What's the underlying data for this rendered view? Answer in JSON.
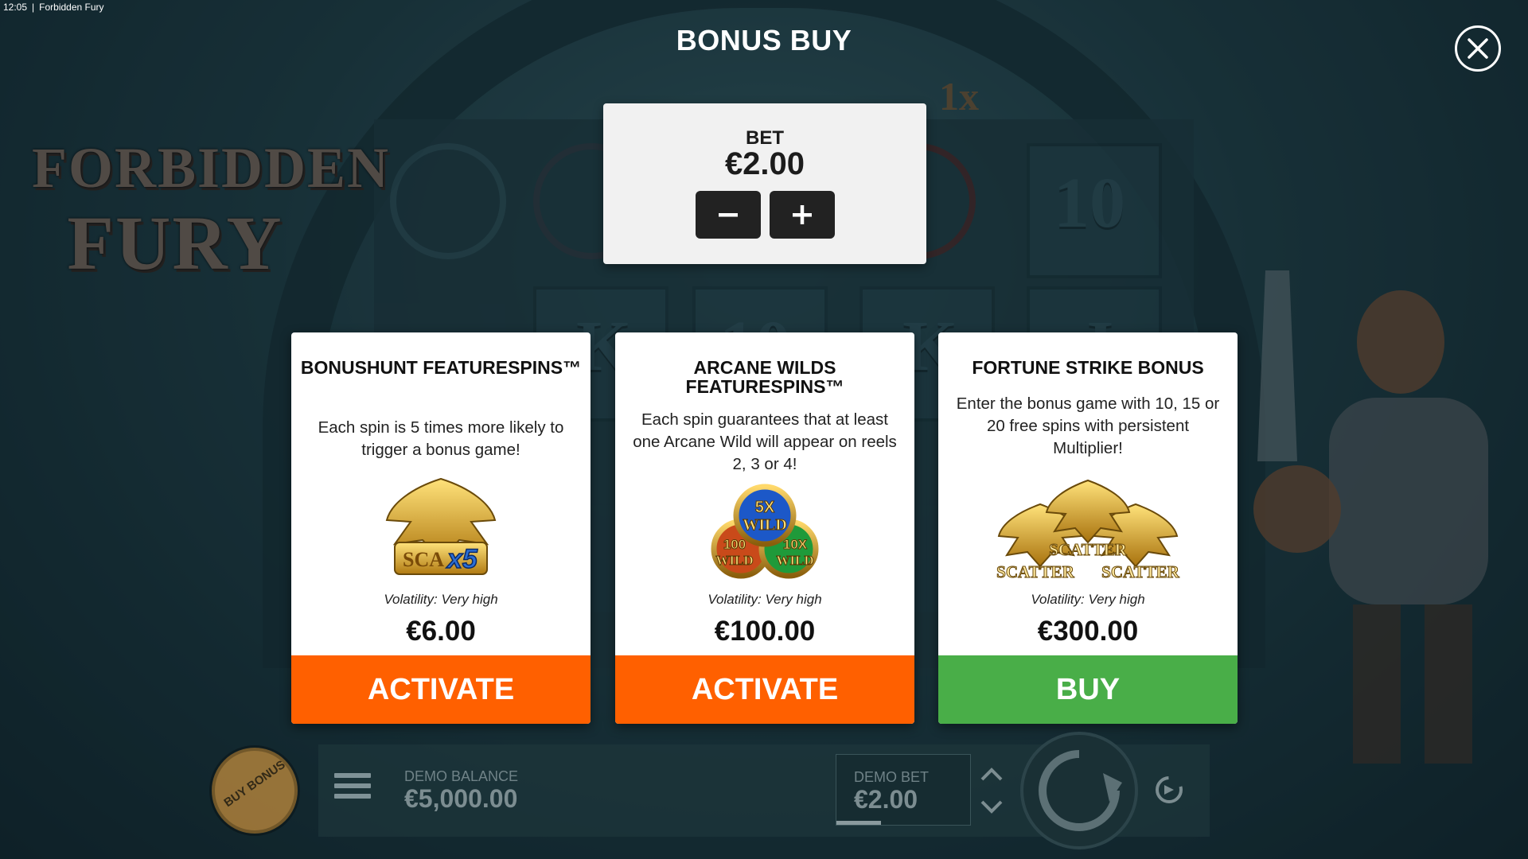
{
  "status_bar": {
    "time": "12:05",
    "app_title": "Forbidden Fury"
  },
  "game": {
    "logo_line1": "FORBIDDEN",
    "logo_line2": "FURY",
    "multiplier": "1x",
    "reel_symbols": [
      "10",
      "K",
      "10",
      "K",
      "J"
    ]
  },
  "dialog": {
    "title": "BONUS BUY"
  },
  "bet_panel": {
    "label": "BET",
    "value": "€2.00"
  },
  "cards": [
    {
      "title": "BONUSHUNT FEATURESPINS™",
      "description": "Each spin is 5 times more likely to trigger a bonus game!",
      "art_text": [
        "SCA",
        "x5"
      ],
      "volatility": "Volatility: Very high",
      "price": "€6.00",
      "action": "ACTIVATE",
      "action_color": "#ff6000"
    },
    {
      "title": "ARCANE WILDS FEATURESPINS™",
      "description": "Each spin guarantees that at least one Arcane Wild will appear on reels 2, 3 or 4!",
      "art_text": [
        "5X",
        "WILD",
        "100",
        "WILD",
        "10X",
        "WILD"
      ],
      "volatility": "Volatility: Very high",
      "price": "€100.00",
      "action": "ACTIVATE",
      "action_color": "#ff6000"
    },
    {
      "title": "FORTUNE STRIKE BONUS",
      "description": "Enter the bonus game with 10, 15 or 20 free spins with persistent Multiplier!",
      "art_text": [
        "SCATTER",
        "SCATTER",
        "SCATTER"
      ],
      "volatility": "Volatility: Very high",
      "price": "€300.00",
      "action": "BUY",
      "action_color": "#49ae48"
    }
  ],
  "bottom_bar": {
    "buy_bonus_label": "BUY BONUS",
    "balance_label": "DEMO BALANCE",
    "balance_value": "€5,000.00",
    "bet_label": "DEMO BET",
    "bet_value": "€2.00"
  },
  "icons": {
    "close": "close-icon",
    "minus": "minus-icon",
    "plus": "plus-icon",
    "menu": "hamburger-menu-icon",
    "bet_arrows": "chevron-up-down-icon",
    "spin": "spin-arrow-icon",
    "autoplay": "autoplay-icon"
  }
}
